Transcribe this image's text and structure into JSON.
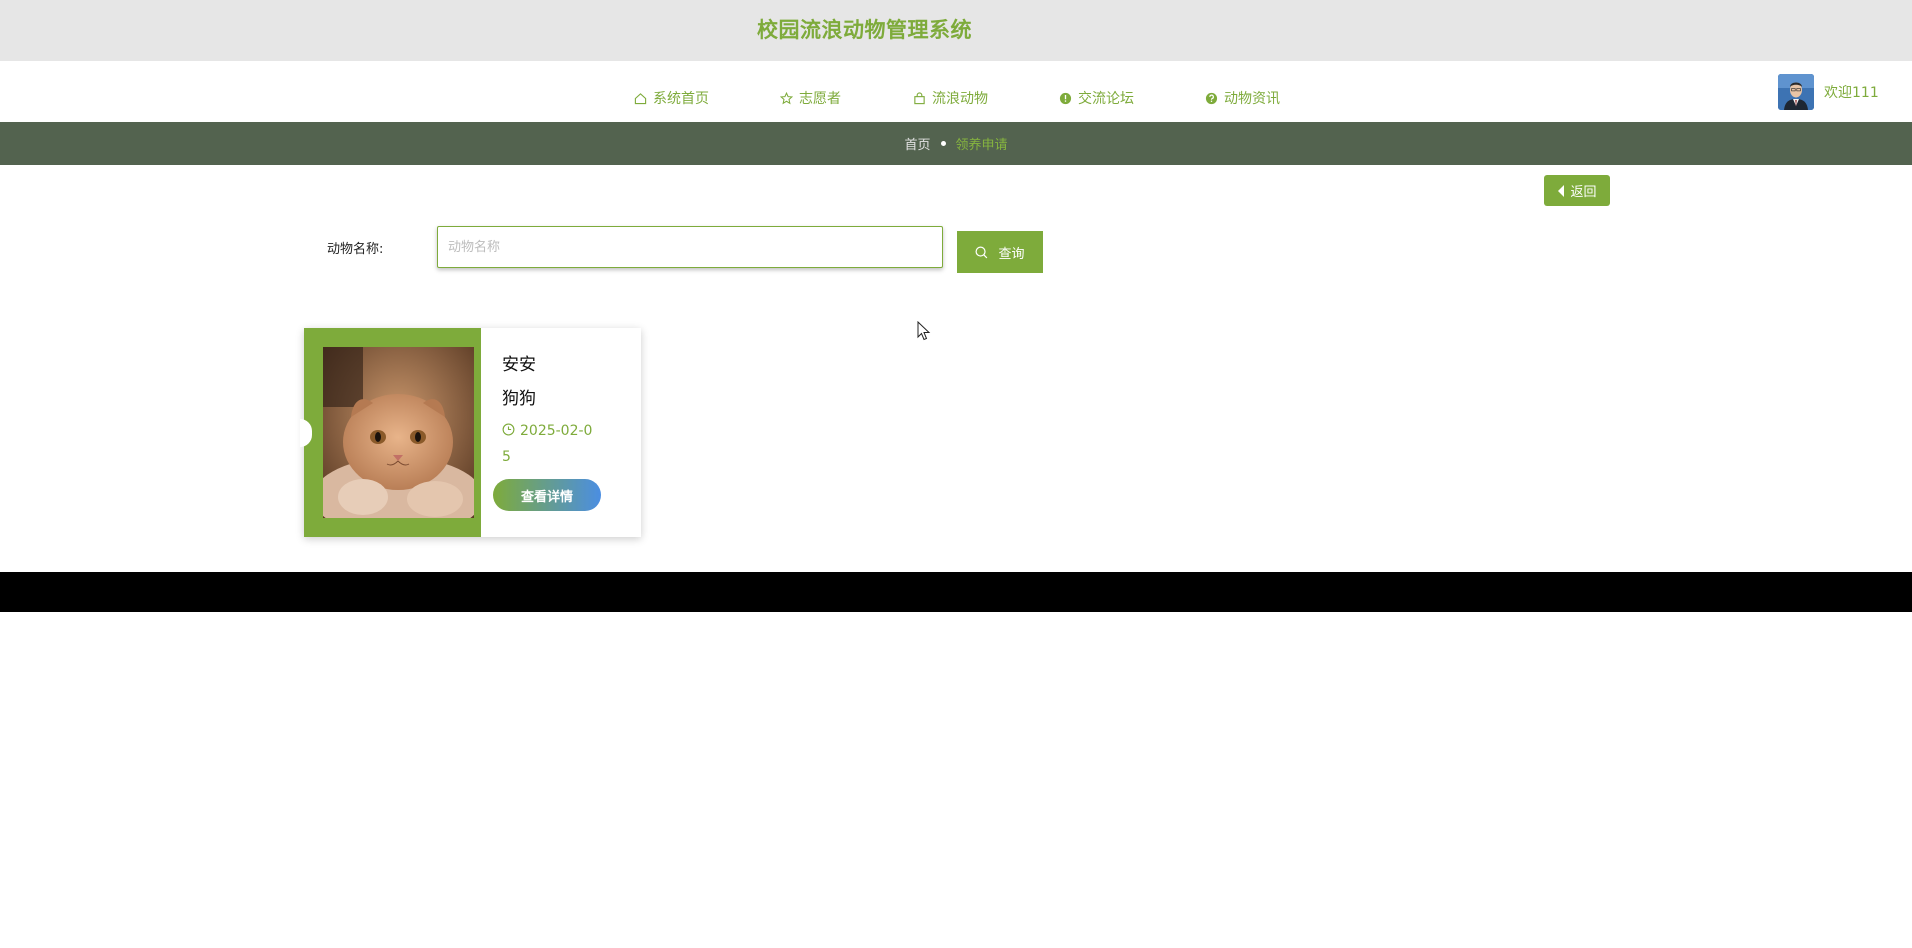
{
  "header": {
    "title": "校园流浪动物管理系统"
  },
  "nav": {
    "items": [
      {
        "label": "系统首页",
        "icon": "home-icon"
      },
      {
        "label": "志愿者",
        "icon": "star-icon"
      },
      {
        "label": "流浪动物",
        "icon": "bag-icon"
      },
      {
        "label": "交流论坛",
        "icon": "info-circle-icon"
      },
      {
        "label": "动物资讯",
        "icon": "question-circle-icon"
      }
    ],
    "welcome": "欢迎111"
  },
  "breadcrumb": {
    "home": "首页",
    "current": "领养申请"
  },
  "back": {
    "label": "返回"
  },
  "search": {
    "label": "动物名称:",
    "placeholder": "动物名称",
    "value": "",
    "button_label": "查询"
  },
  "cards": [
    {
      "name": "安安",
      "type": "狗狗",
      "date": "2025-02-05",
      "button_label": "查看详情"
    }
  ],
  "colors": {
    "accent": "#7eab3b",
    "breadcrumb_bg": "#53634f",
    "topbar_bg": "#e6e6e6",
    "footer_bg": "#000000",
    "gradient_end": "#4b8ee2"
  }
}
